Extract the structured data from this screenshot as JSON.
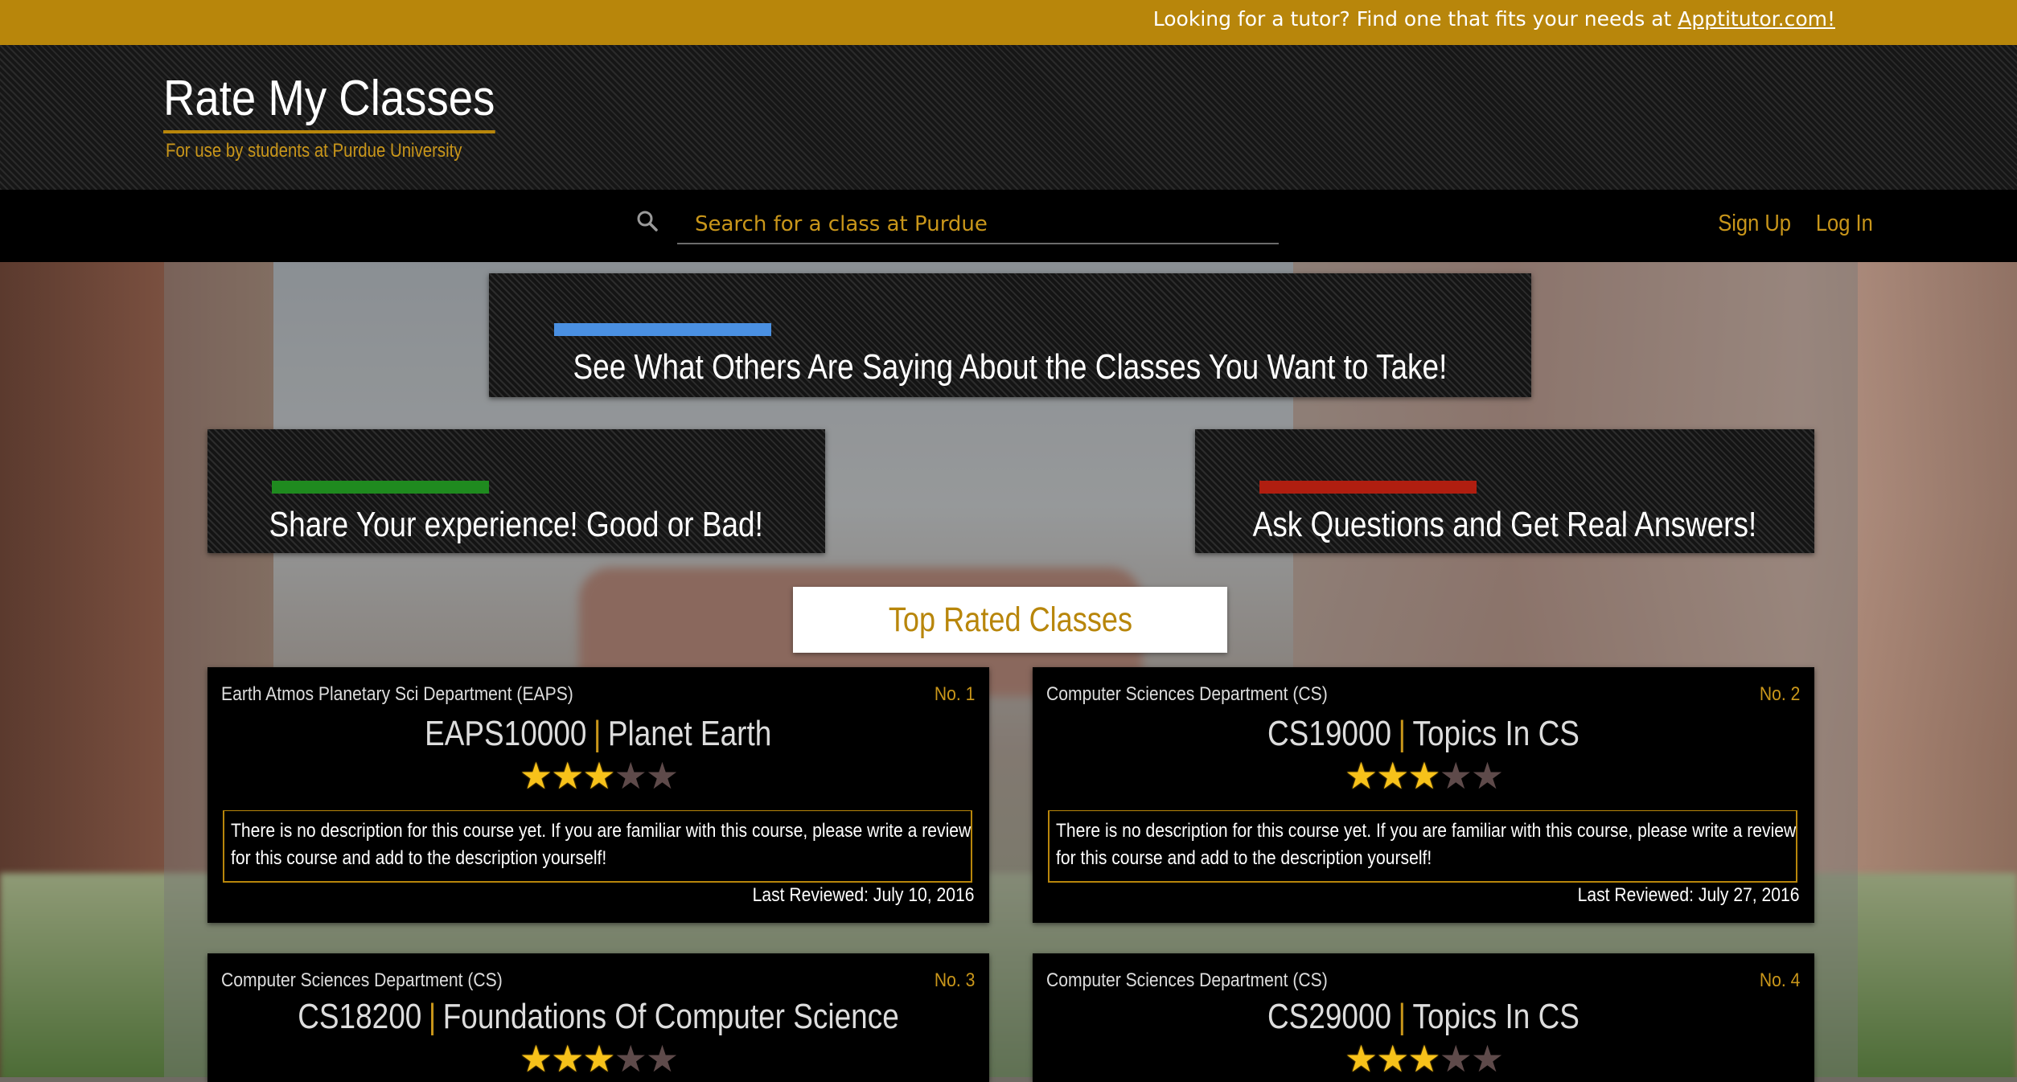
{
  "topbar": {
    "text": "Looking for a tutor? Find one that fits your needs at ",
    "link": "Apptitutor.com!"
  },
  "header": {
    "title": "Rate My Classes",
    "subtitle": "For use by students at Purdue University"
  },
  "nav": {
    "search_icon": "search-icon",
    "search_placeholder": "Search for a class at Purdue",
    "signup": "Sign Up",
    "login": "Log In"
  },
  "tiles": [
    {
      "text": "See What Others Are Saying About the Classes You Want to Take!",
      "accent": "#4a90e2"
    },
    {
      "text": "Share Your experience! Good or Bad!",
      "accent": "#1f8a1f"
    },
    {
      "text": "Ask Questions and Get Real Answers!",
      "accent": "#b01e10"
    }
  ],
  "top_rated_label": "Top Rated Classes",
  "colors": {
    "gold": "#b8860b",
    "star": "#f7c21a"
  },
  "classes": [
    {
      "department": "Earth Atmos Planetary Sci Department (EAPS)",
      "rank": "No. 1",
      "code": "EAPS10000",
      "separator": "|",
      "name": "Planet Earth",
      "rating": 3,
      "max_rating": 5,
      "description": "There is no description for this course yet. If you are familiar with this course, please write a review for this course and add to the description yourself!",
      "last_reviewed": "Last Reviewed: July 10, 2016"
    },
    {
      "department": "Computer Sciences Department (CS)",
      "rank": "No. 2",
      "code": "CS19000",
      "separator": "|",
      "name": "Topics In CS",
      "rating": 3,
      "max_rating": 5,
      "description": "There is no description for this course yet. If you are familiar with this course, please write a review for this course and add to the description yourself!",
      "last_reviewed": "Last Reviewed: July 27, 2016"
    },
    {
      "department": "Computer Sciences Department (CS)",
      "rank": "No. 3",
      "code": "CS18200",
      "separator": "|",
      "name": "Foundations Of Computer Science",
      "rating": 3,
      "max_rating": 5
    },
    {
      "department": "Computer Sciences Department (CS)",
      "rank": "No. 4",
      "code": "CS29000",
      "separator": "|",
      "name": "Topics In CS",
      "rating": 3,
      "max_rating": 5
    }
  ]
}
